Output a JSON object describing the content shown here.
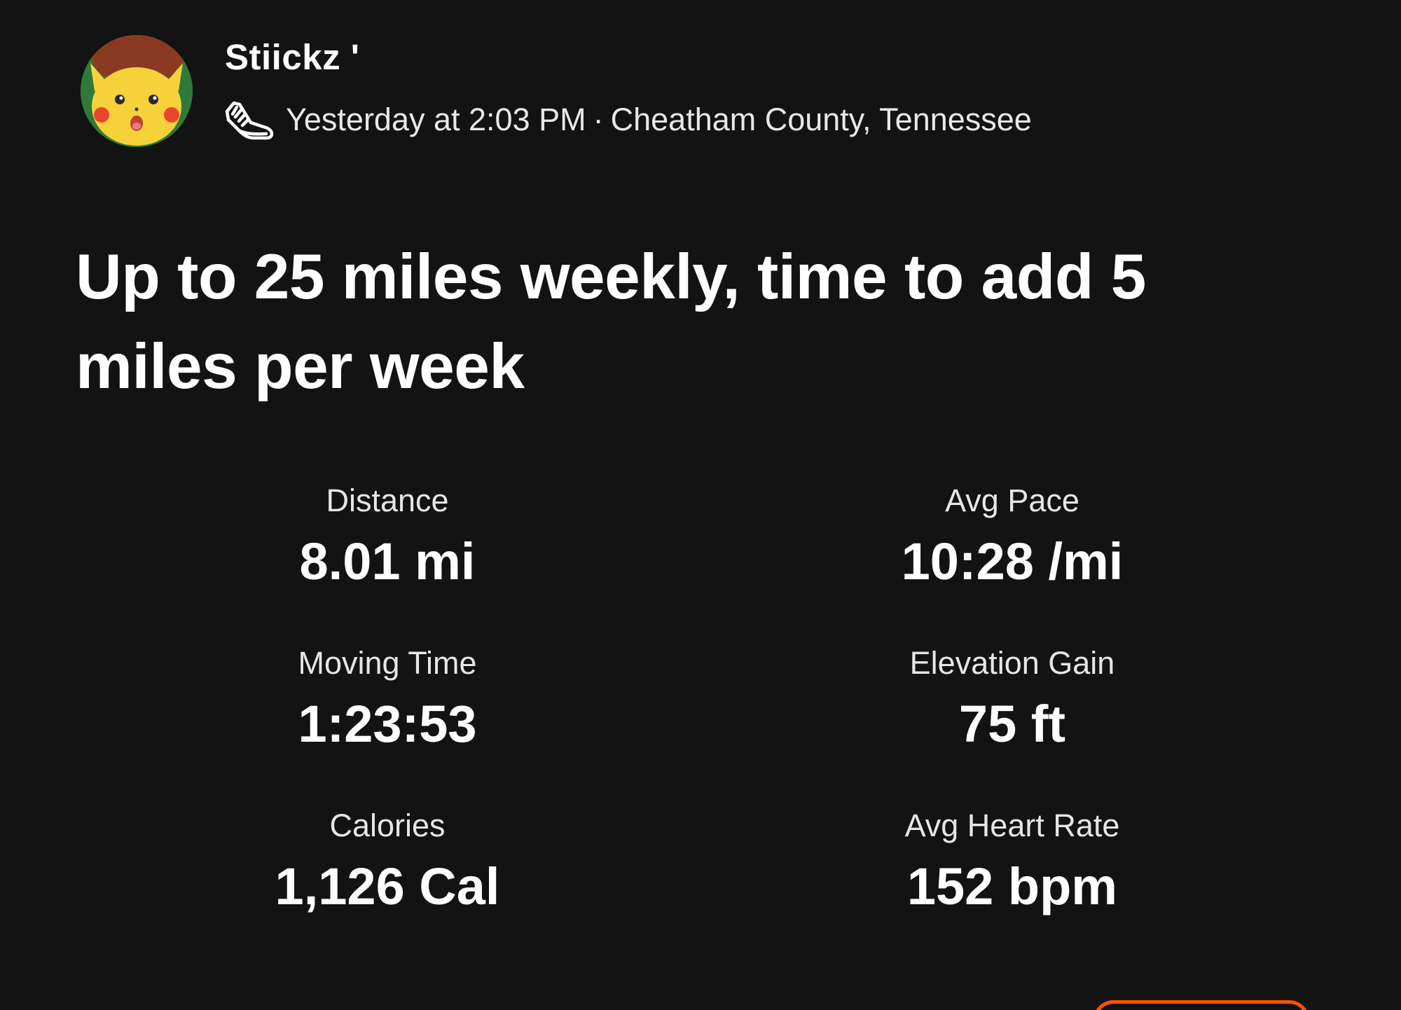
{
  "post": {
    "user_name": "Stiickz '",
    "timestamp": "Yesterday at 2:03 PM",
    "separator": "·",
    "location": "Cheatham County, Tennessee",
    "activity_icon": "running-shoe-icon",
    "title": "Up to 25 miles weekly, time to add 5 miles per week"
  },
  "stats": {
    "distance": {
      "label": "Distance",
      "value": "8.01 mi"
    },
    "avg_pace": {
      "label": "Avg Pace",
      "value": "10:28 /mi"
    },
    "moving_time": {
      "label": "Moving Time",
      "value": "1:23:53"
    },
    "elevation_gain": {
      "label": "Elevation Gain",
      "value": "75 ft"
    },
    "calories": {
      "label": "Calories",
      "value": "1,126 Cal"
    },
    "avg_heart_rate": {
      "label": "Avg Heart Rate",
      "value": "152 bpm"
    }
  },
  "colors": {
    "background": "#131313",
    "text": "#ffffff",
    "accent": "#fc5200"
  }
}
